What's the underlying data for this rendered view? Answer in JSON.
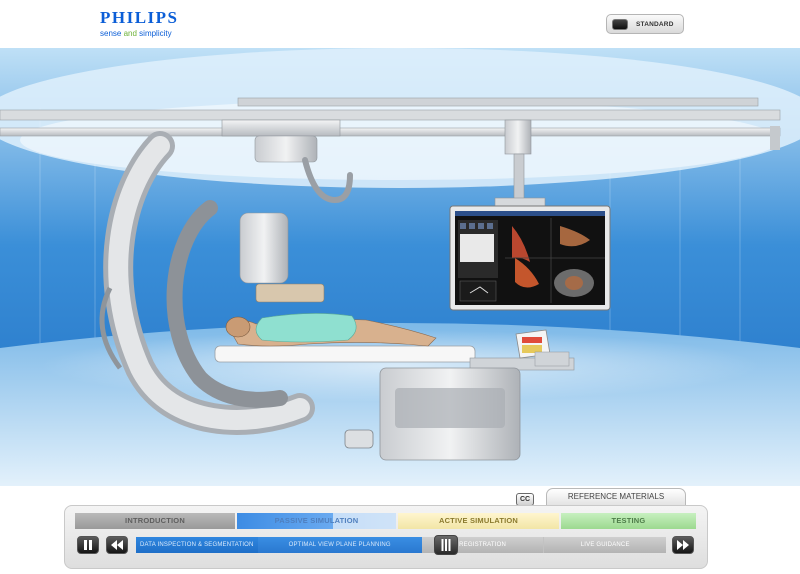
{
  "header": {
    "logo": {
      "wordmark": "PHILIPS",
      "tagline_pre": "sense ",
      "tagline_accent": "and",
      "tagline_post": " simplicity"
    },
    "standard_button": {
      "label": "STANDARD",
      "icon": "monitor-toggle-icon"
    }
  },
  "controls": {
    "cc_label": "CC",
    "reference_label": "REFERENCE MATERIALS",
    "tabs": [
      {
        "label": "INTRODUCTION",
        "state": "completed"
      },
      {
        "label": "PASSIVE SIMULATION",
        "state": "active",
        "progress_percent": 60
      },
      {
        "label": "ACTIVE SIMULATION",
        "state": "upcoming"
      },
      {
        "label": "TESTING",
        "state": "upcoming"
      }
    ],
    "steps": [
      {
        "label": "DATA INSPECTION & SEGMENTATION",
        "state": "completed"
      },
      {
        "label": "OPTIMAL VIEW PLANE PLANNING",
        "state": "active"
      },
      {
        "label": "REGISTRATION",
        "state": "upcoming"
      },
      {
        "label": "LIVE GUIDANCE",
        "state": "upcoming"
      }
    ],
    "buttons": {
      "pause": "pause-icon",
      "rewind": "rewind-icon",
      "forward": "fast-forward-icon",
      "scrubber": "scrubber-handle-icon"
    }
  },
  "colors": {
    "brand_blue": "#0b5ed7",
    "brand_green": "#6fb33a",
    "active_blue": "#2f86df",
    "tab_intro": "#a8a8a8",
    "tab_active_sim": "#f7eebe",
    "tab_testing": "#b6e6ab"
  }
}
